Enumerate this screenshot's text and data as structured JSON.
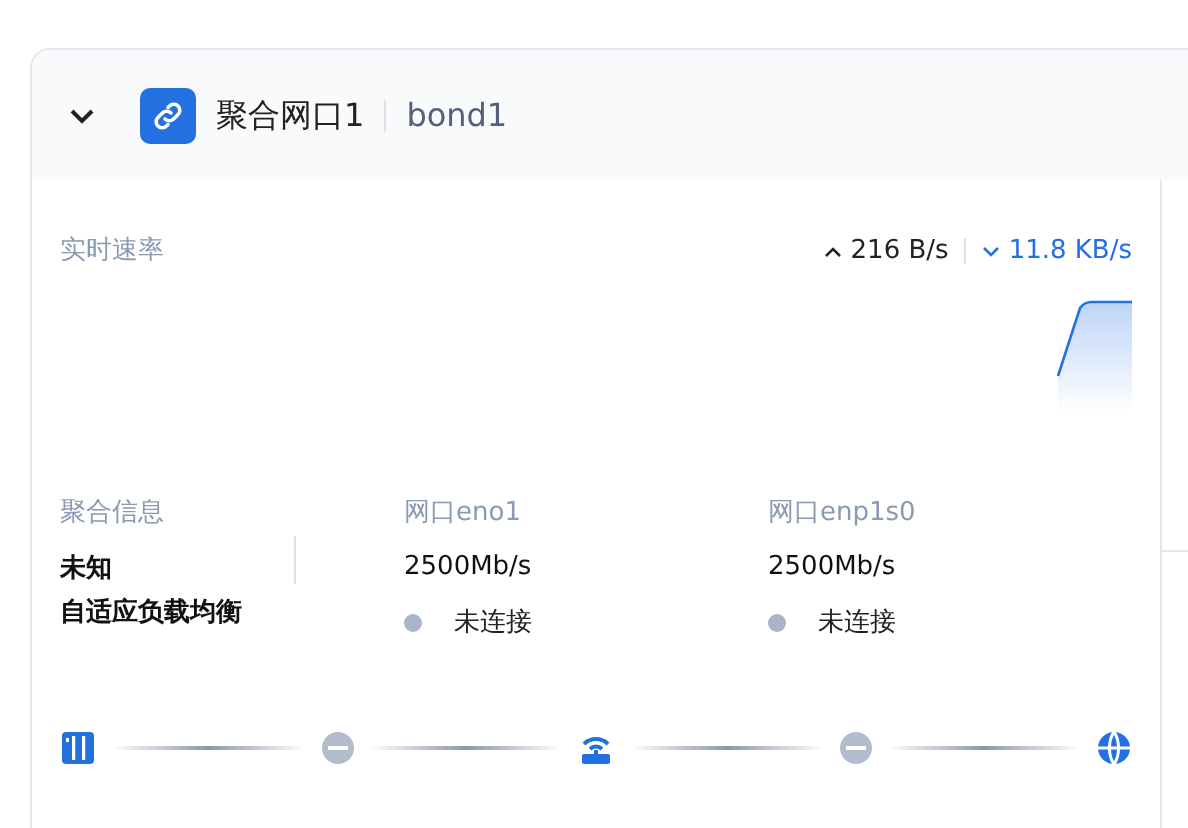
{
  "header": {
    "expanded": true,
    "title": "聚合网口1",
    "subtitle": "bond1"
  },
  "rate": {
    "label": "实时速率",
    "upload": "216 B/s",
    "download": "11.8 KB/s"
  },
  "bond_info": {
    "label": "聚合信息",
    "values": [
      "未知",
      "自适应负载均衡"
    ]
  },
  "ports": [
    {
      "label": "网口eno1",
      "speed": "2500Mb/s",
      "status": "未连接",
      "connected": false
    },
    {
      "label": "网口enp1s0",
      "speed": "2500Mb/s",
      "status": "未连接",
      "connected": false
    }
  ]
}
